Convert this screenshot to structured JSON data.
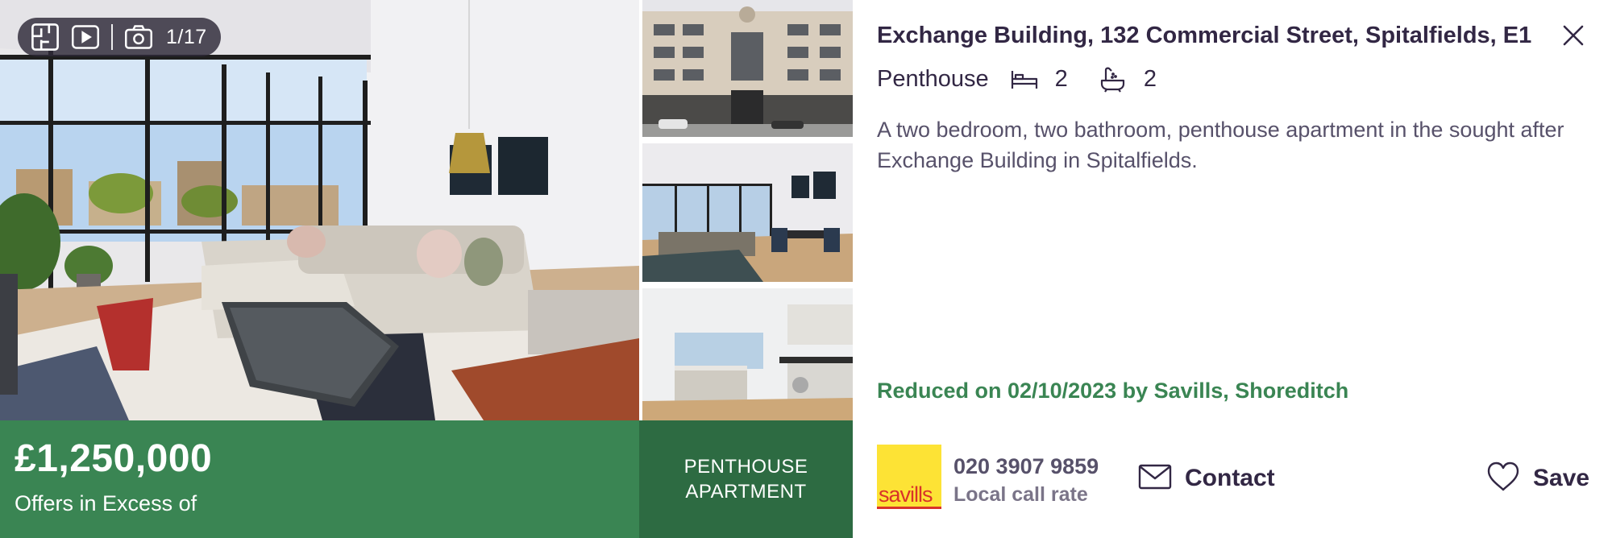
{
  "gallery": {
    "photo_counter": "1/17",
    "icons": [
      "floorplan-icon",
      "video-icon",
      "camera-icon"
    ]
  },
  "listing": {
    "price": "£1,250,000",
    "price_qualifier": "Offers in Excess of",
    "property_type_badge_line1": "PENTHOUSE",
    "property_type_badge_line2": "APARTMENT",
    "address": "Exchange Building, 132 Commercial Street, Spitalfields, E1",
    "property_type": "Penthouse",
    "bedrooms": "2",
    "bathrooms": "2",
    "description": "A two bedroom, two bathroom, penthouse apartment in the sought after Exchange Building in Spitalfields.",
    "reduced_note": "Reduced on 02/10/2023 by Savills, Shoreditch"
  },
  "agent": {
    "logo_text": "savills",
    "phone": "020 3907 9859",
    "call_rate": "Local call rate"
  },
  "actions": {
    "contact_label": "Contact",
    "save_label": "Save"
  },
  "colors": {
    "accent_green": "#3a8553",
    "dark_green": "#2d6b42",
    "text_primary": "#322744",
    "logo_yellow": "#fde335",
    "logo_red": "#d8332a"
  }
}
